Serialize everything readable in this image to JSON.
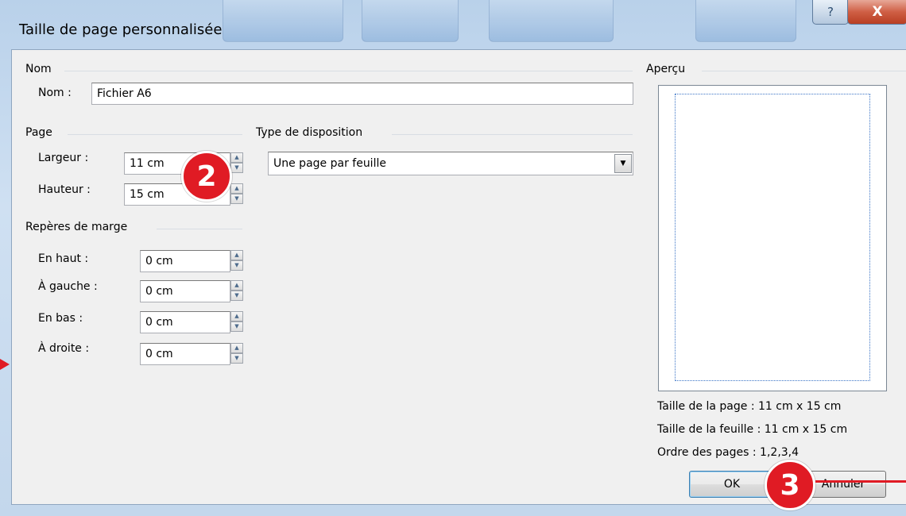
{
  "window": {
    "title": "Taille de page personnalisée",
    "help_glyph": "?",
    "close_glyph": "X"
  },
  "name_group": {
    "title": "Nom",
    "label": "Nom :",
    "value": "Fichier A6"
  },
  "page_group": {
    "title": "Page",
    "width_label": "Largeur :",
    "width_value": "11 cm",
    "height_label": "Hauteur :",
    "height_value": "15 cm"
  },
  "layout_group": {
    "title": "Type de disposition",
    "selected": "Une page par feuille"
  },
  "margin_group": {
    "title": "Repères de marge",
    "top_label": "En haut :",
    "top_value": "0 cm",
    "left_label": "À gauche :",
    "left_value": "0 cm",
    "bottom_label": "En bas :",
    "bottom_value": "0 cm",
    "right_label": "À droite :",
    "right_value": "0 cm"
  },
  "preview": {
    "title": "Aperçu",
    "page_size": "Taille de la page : 11 cm x 15 cm",
    "sheet_size": "Taille de la feuille : 11 cm x 15 cm",
    "page_order": "Ordre des pages : 1,2,3,4"
  },
  "buttons": {
    "ok": "OK",
    "cancel": "Annuler"
  },
  "callouts": {
    "step2": "2",
    "step3": "3",
    "color": "#e01b24"
  },
  "icons": {
    "spin_up": "▲",
    "spin_down": "▼",
    "combo": "▼"
  }
}
